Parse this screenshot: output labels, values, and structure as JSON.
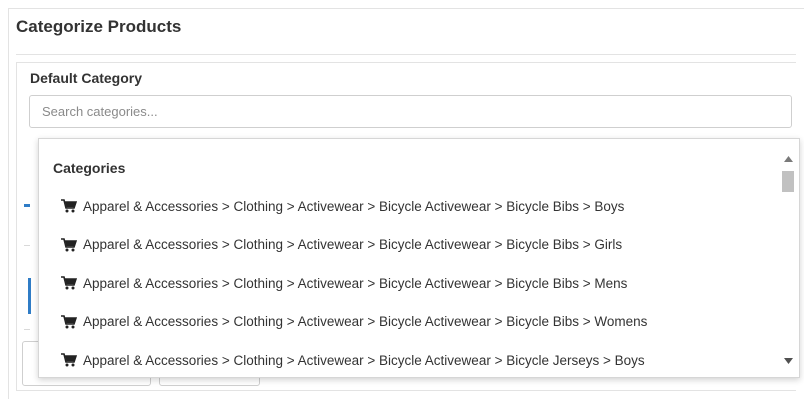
{
  "panel": {
    "title": "Categorize Products"
  },
  "default_category": {
    "label": "Default Category",
    "search_placeholder": "Search categories...",
    "search_value": ""
  },
  "dropdown": {
    "header": "Categories",
    "options": [
      {
        "icon": "cart-icon",
        "label": "Apparel & Accessories > Clothing > Activewear > Bicycle Activewear > Bicycle Bibs > Boys"
      },
      {
        "icon": "cart-icon",
        "label": "Apparel & Accessories > Clothing > Activewear > Bicycle Activewear > Bicycle Bibs > Girls"
      },
      {
        "icon": "cart-icon",
        "label": "Apparel & Accessories > Clothing > Activewear > Bicycle Activewear > Bicycle Bibs > Mens"
      },
      {
        "icon": "cart-icon",
        "label": "Apparel & Accessories > Clothing > Activewear > Bicycle Activewear > Bicycle Bibs > Womens"
      },
      {
        "icon": "cart-icon",
        "label": "Apparel & Accessories > Clothing > Activewear > Bicycle Activewear > Bicycle Jerseys > Boys"
      }
    ]
  },
  "colors": {
    "accent": "#2f7cc6",
    "border": "#e3e3e3",
    "text": "#333333",
    "placeholder": "#8a8a8a",
    "scroll_thumb": "#c1c1c1"
  },
  "icons": {
    "scroll_up": "triangle-up-icon",
    "scroll_down": "triangle-down-icon"
  }
}
